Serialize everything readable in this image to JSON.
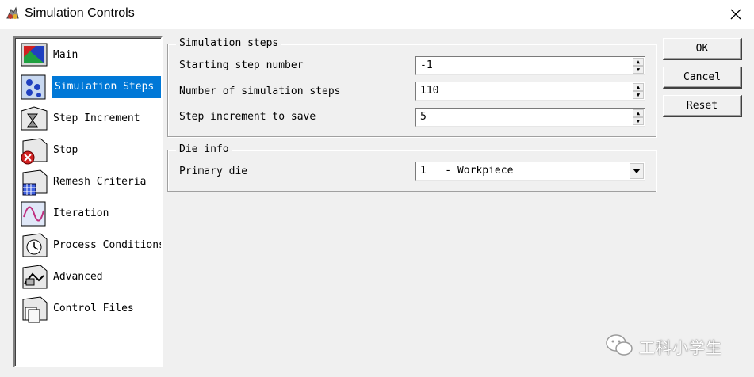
{
  "window": {
    "title": "Simulation Controls",
    "close_label": "close"
  },
  "nav": {
    "items": [
      {
        "label": "Main",
        "icon": "main-icon"
      },
      {
        "label": "Simulation Steps",
        "icon": "simulation-steps-icon",
        "selected": true
      },
      {
        "label": "Step Increment",
        "icon": "step-increment-icon"
      },
      {
        "label": "Stop",
        "icon": "stop-icon"
      },
      {
        "label": "Remesh Criteria",
        "icon": "remesh-criteria-icon"
      },
      {
        "label": "Iteration",
        "icon": "iteration-icon"
      },
      {
        "label": "Process Conditions",
        "icon": "process-conditions-icon"
      },
      {
        "label": "Advanced",
        "icon": "advanced-icon"
      },
      {
        "label": "Control Files",
        "icon": "control-files-icon"
      }
    ]
  },
  "simulation_steps": {
    "title": "Simulation steps",
    "starting_step": {
      "label": "Starting step number",
      "value": "-1"
    },
    "num_steps": {
      "label": "Number of simulation steps",
      "value": "110"
    },
    "step_increment": {
      "label": "Step increment to save",
      "value": "5"
    }
  },
  "die_info": {
    "title": "Die info",
    "primary_die": {
      "label": "Primary die",
      "value": "1   - Workpiece"
    }
  },
  "buttons": {
    "ok": "OK",
    "cancel": "Cancel",
    "reset": "Reset"
  },
  "watermark": {
    "text": "工科小学生"
  },
  "colors": {
    "selection": "#0078d7",
    "background": "#f0f0f0"
  }
}
